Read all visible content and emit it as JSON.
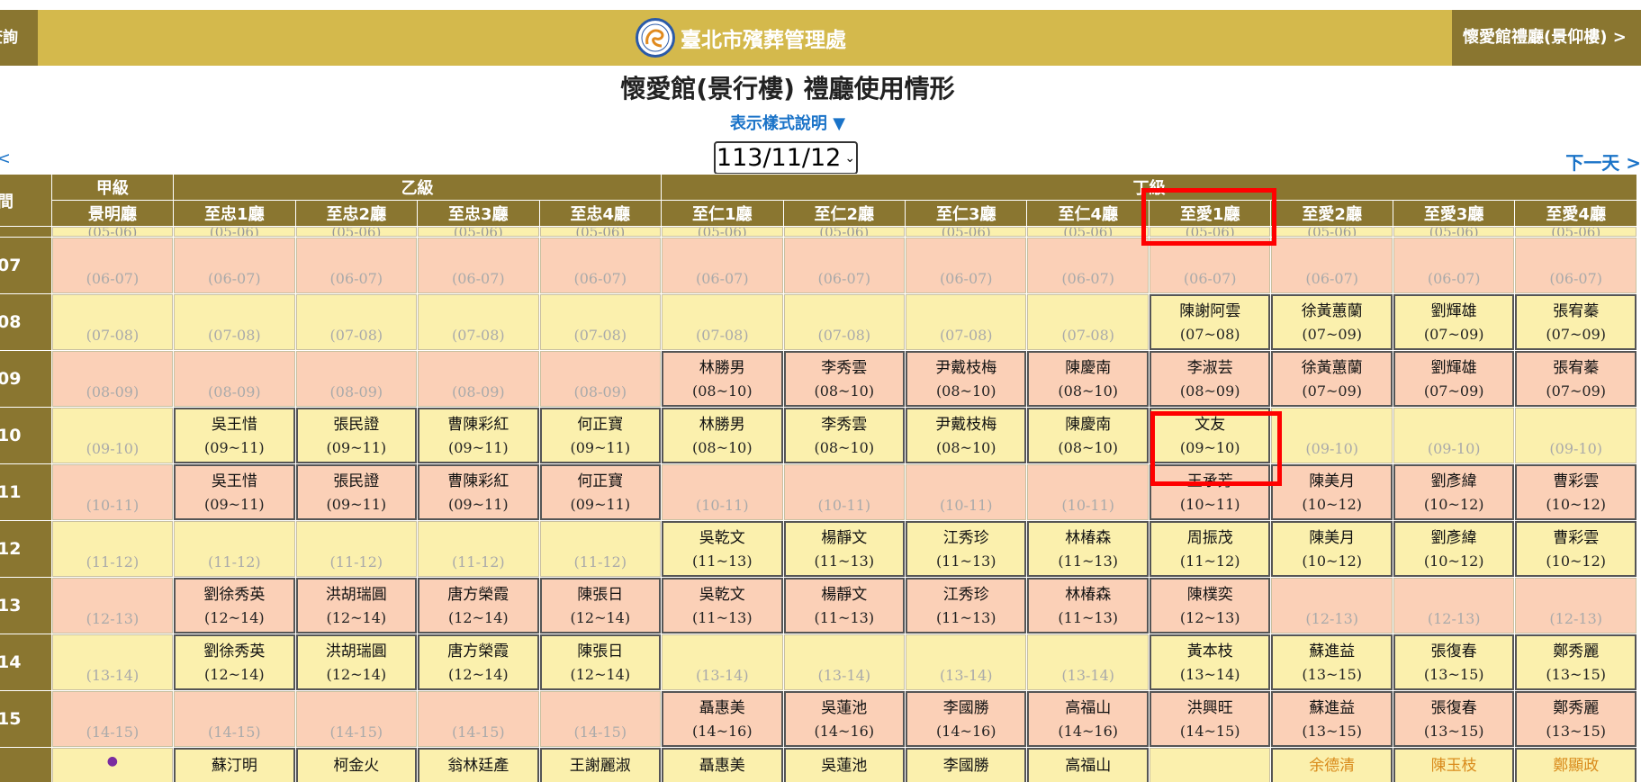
{
  "topbar": {
    "left_label": "查詢",
    "brand_title": "臺北市殯葬管理處",
    "right_label": "懷愛館禮廳(景仰樓) >"
  },
  "page": {
    "title": "懷愛館(景行樓) 禮廳使用情形",
    "legend_link": "表示樣式說明 ▼",
    "prev_link": "<",
    "date_selected": "113/11/12",
    "next_link": "下一天 >"
  },
  "grid": {
    "corner_label": "間",
    "grade_groups": [
      {
        "label": "甲級",
        "span": 1
      },
      {
        "label": "乙級",
        "span": 4
      },
      {
        "label": "丁級",
        "span": 8
      }
    ],
    "halls": [
      "景明廳",
      "至忠1廳",
      "至忠2廳",
      "至忠3廳",
      "至忠4廳",
      "至仁1廳",
      "至仁2廳",
      "至仁3廳",
      "至仁4廳",
      "至愛1廳",
      "至愛2廳",
      "至愛3廳",
      "至愛4廳"
    ],
    "partial_top_range": "(05-06)",
    "rows": [
      {
        "hour": "07",
        "cells": [
          {
            "range": "(06-07)"
          },
          {
            "range": "(06-07)"
          },
          {
            "range": "(06-07)"
          },
          {
            "range": "(06-07)"
          },
          {
            "range": "(06-07)"
          },
          {
            "range": "(06-07)"
          },
          {
            "range": "(06-07)"
          },
          {
            "range": "(06-07)"
          },
          {
            "range": "(06-07)"
          },
          {
            "range": "(06-07)"
          },
          {
            "range": "(06-07)"
          },
          {
            "range": "(06-07)"
          },
          {
            "range": "(06-07)"
          }
        ]
      },
      {
        "hour": "08",
        "cells": [
          {
            "range": "(07-08)"
          },
          {
            "range": "(07-08)"
          },
          {
            "range": "(07-08)"
          },
          {
            "range": "(07-08)"
          },
          {
            "range": "(07-08)"
          },
          {
            "range": "(07-08)"
          },
          {
            "range": "(07-08)"
          },
          {
            "range": "(07-08)"
          },
          {
            "range": "(07-08)"
          },
          {
            "name": "陳謝阿雲",
            "range": "(07~08)"
          },
          {
            "name": "徐黃蕙蘭",
            "range": "(07~09)"
          },
          {
            "name": "劉輝雄",
            "range": "(07~09)"
          },
          {
            "name": "張宥蓁",
            "range": "(07~09)"
          }
        ]
      },
      {
        "hour": "09",
        "cells": [
          {
            "range": "(08-09)"
          },
          {
            "range": "(08-09)"
          },
          {
            "range": "(08-09)"
          },
          {
            "range": "(08-09)"
          },
          {
            "range": "(08-09)"
          },
          {
            "name": "林勝男",
            "range": "(08~10)"
          },
          {
            "name": "李秀雲",
            "range": "(08~10)"
          },
          {
            "name": "尹戴枝梅",
            "range": "(08~10)"
          },
          {
            "name": "陳慶南",
            "range": "(08~10)"
          },
          {
            "name": "李淑芸",
            "range": "(08~09)"
          },
          {
            "name": "徐黃蕙蘭",
            "range": "(07~09)"
          },
          {
            "name": "劉輝雄",
            "range": "(07~09)"
          },
          {
            "name": "張宥蓁",
            "range": "(07~09)"
          }
        ]
      },
      {
        "hour": "10",
        "cells": [
          {
            "range": "(09-10)"
          },
          {
            "name": "吳王惜",
            "range": "(09~11)"
          },
          {
            "name": "張民證",
            "range": "(09~11)"
          },
          {
            "name": "曹陳彩紅",
            "range": "(09~11)"
          },
          {
            "name": "何正寶",
            "range": "(09~11)"
          },
          {
            "name": "林勝男",
            "range": "(08~10)"
          },
          {
            "name": "李秀雲",
            "range": "(08~10)"
          },
          {
            "name": "尹戴枝梅",
            "range": "(08~10)"
          },
          {
            "name": "陳慶南",
            "range": "(08~10)"
          },
          {
            "name": "文友",
            "range": "(09~10)"
          },
          {
            "range": "(09-10)"
          },
          {
            "range": "(09-10)"
          },
          {
            "range": "(09-10)"
          }
        ]
      },
      {
        "hour": "11",
        "cells": [
          {
            "range": "(10-11)"
          },
          {
            "name": "吳王惜",
            "range": "(09~11)"
          },
          {
            "name": "張民證",
            "range": "(09~11)"
          },
          {
            "name": "曹陳彩紅",
            "range": "(09~11)"
          },
          {
            "name": "何正寶",
            "range": "(09~11)"
          },
          {
            "range": "(10-11)"
          },
          {
            "range": "(10-11)"
          },
          {
            "range": "(10-11)"
          },
          {
            "range": "(10-11)"
          },
          {
            "name": "王承芳",
            "range": "(10~11)"
          },
          {
            "name": "陳美月",
            "range": "(10~12)"
          },
          {
            "name": "劉彥緯",
            "range": "(10~12)"
          },
          {
            "name": "曹彩雲",
            "range": "(10~12)"
          }
        ]
      },
      {
        "hour": "12",
        "cells": [
          {
            "range": "(11-12)"
          },
          {
            "range": "(11-12)"
          },
          {
            "range": "(11-12)"
          },
          {
            "range": "(11-12)"
          },
          {
            "range": "(11-12)"
          },
          {
            "name": "吳乾文",
            "range": "(11~13)"
          },
          {
            "name": "楊靜文",
            "range": "(11~13)"
          },
          {
            "name": "江秀珍",
            "range": "(11~13)"
          },
          {
            "name": "林椿森",
            "range": "(11~13)"
          },
          {
            "name": "周振茂",
            "range": "(11~12)"
          },
          {
            "name": "陳美月",
            "range": "(10~12)"
          },
          {
            "name": "劉彥緯",
            "range": "(10~12)"
          },
          {
            "name": "曹彩雲",
            "range": "(10~12)"
          }
        ]
      },
      {
        "hour": "13",
        "cells": [
          {
            "range": "(12-13)"
          },
          {
            "name": "劉徐秀英",
            "range": "(12~14)"
          },
          {
            "name": "洪胡瑞圓",
            "range": "(12~14)"
          },
          {
            "name": "唐方榮霞",
            "range": "(12~14)"
          },
          {
            "name": "陳張日",
            "range": "(12~14)"
          },
          {
            "name": "吳乾文",
            "range": "(11~13)"
          },
          {
            "name": "楊靜文",
            "range": "(11~13)"
          },
          {
            "name": "江秀珍",
            "range": "(11~13)"
          },
          {
            "name": "林椿森",
            "range": "(11~13)"
          },
          {
            "name": "陳樸奕",
            "range": "(12~13)"
          },
          {
            "range": "(12-13)"
          },
          {
            "range": "(12-13)"
          },
          {
            "range": "(12-13)"
          }
        ]
      },
      {
        "hour": "14",
        "cells": [
          {
            "range": "(13-14)"
          },
          {
            "name": "劉徐秀英",
            "range": "(12~14)"
          },
          {
            "name": "洪胡瑞圓",
            "range": "(12~14)"
          },
          {
            "name": "唐方榮霞",
            "range": "(12~14)"
          },
          {
            "name": "陳張日",
            "range": "(12~14)"
          },
          {
            "range": "(13-14)"
          },
          {
            "range": "(13-14)"
          },
          {
            "range": "(13-14)"
          },
          {
            "range": "(13-14)"
          },
          {
            "name": "黃本枝",
            "range": "(13~14)"
          },
          {
            "name": "蘇進益",
            "range": "(13~15)"
          },
          {
            "name": "張復春",
            "range": "(13~15)"
          },
          {
            "name": "鄭秀麗",
            "range": "(13~15)"
          }
        ]
      },
      {
        "hour": "15",
        "cells": [
          {
            "range": "(14-15)"
          },
          {
            "range": "(14-15)"
          },
          {
            "range": "(14-15)"
          },
          {
            "range": "(14-15)"
          },
          {
            "range": "(14-15)"
          },
          {
            "name": "聶惠美",
            "range": "(14~16)"
          },
          {
            "name": "吳蓮池",
            "range": "(14~16)"
          },
          {
            "name": "李國勝",
            "range": "(14~16)"
          },
          {
            "name": "高福山",
            "range": "(14~16)"
          },
          {
            "name": "洪興旺",
            "range": "(14~15)"
          },
          {
            "name": "蘇進益",
            "range": "(13~15)"
          },
          {
            "name": "張復春",
            "range": "(13~15)"
          },
          {
            "name": "鄭秀麗",
            "range": "(13~15)"
          }
        ]
      }
    ],
    "last_row": [
      {
        "dot": "●"
      },
      {
        "name": "蘇汀明"
      },
      {
        "name": "柯金火"
      },
      {
        "name": "翁林廷產"
      },
      {
        "name": "王謝麗淑"
      },
      {
        "name": "聶惠美"
      },
      {
        "name": "吳蓮池"
      },
      {
        "name": "李國勝"
      },
      {
        "name": "高福山"
      },
      {},
      {
        "name": "余德清",
        "orange": true
      },
      {
        "name": "陳玉枝",
        "orange": true
      },
      {
        "name": "鄭顯政",
        "orange": true
      }
    ]
  },
  "colors": {
    "header_gold": "#d4b94c",
    "header_dark": "#8a7630",
    "row_salmon": "#fbd0b7",
    "row_yellow": "#fbf0ad",
    "link_blue": "#1a73c8",
    "highlight_red": "#ff0000"
  }
}
